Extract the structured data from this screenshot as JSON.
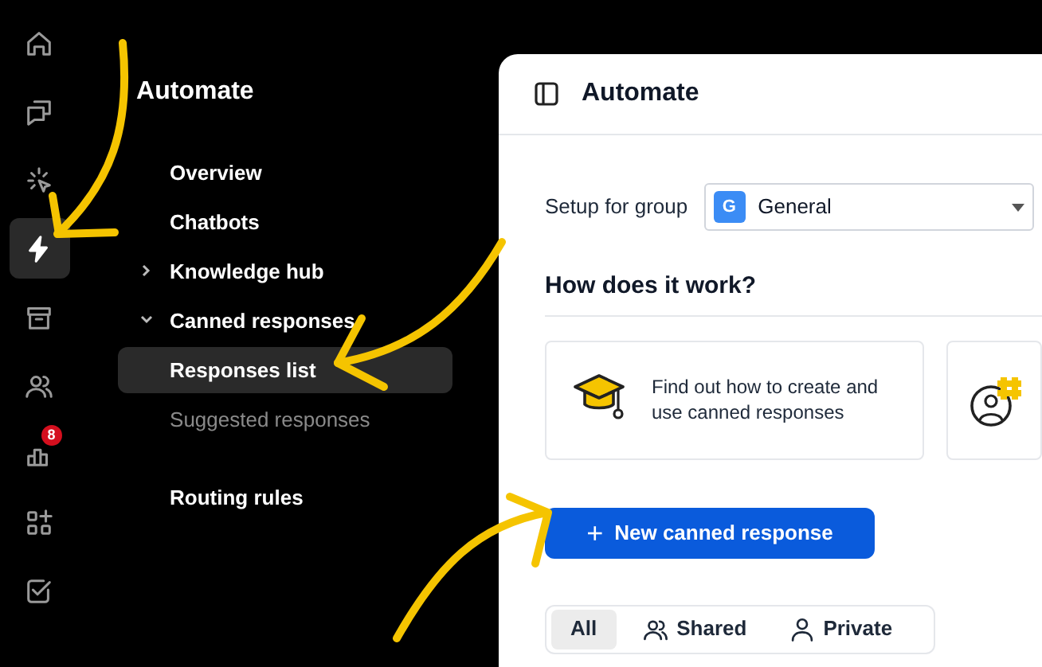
{
  "rail": [
    {
      "kind": "home",
      "selected": false
    },
    {
      "kind": "chat",
      "selected": false
    },
    {
      "kind": "spark",
      "selected": false
    },
    {
      "kind": "bolt",
      "selected": true
    },
    {
      "kind": "archive",
      "selected": false
    },
    {
      "kind": "team",
      "selected": false
    },
    {
      "kind": "chart",
      "selected": false,
      "badge": "8"
    },
    {
      "kind": "apps",
      "selected": false
    },
    {
      "kind": "check",
      "selected": false
    }
  ],
  "nav": {
    "title": "Automate",
    "items": [
      {
        "label": "Overview",
        "selected": false
      },
      {
        "label": "Chatbots",
        "selected": false
      },
      {
        "label": "Knowledge hub",
        "selected": false,
        "expanded": false
      },
      {
        "label": "Canned responses",
        "selected": false,
        "expanded": true,
        "children": [
          {
            "label": "Responses list",
            "selected": true
          },
          {
            "label": "Suggested responses",
            "selected": false
          }
        ]
      }
    ],
    "more_items": [
      {
        "label": "Routing rules",
        "selected": false
      }
    ]
  },
  "main": {
    "title": "Automate",
    "group_label": "Setup for group",
    "group": {
      "initial": "G",
      "name": "General"
    },
    "section_title": "How does it work?",
    "cards": [
      {
        "kind": "graduation",
        "text": "Find out how to create and use canned responses"
      },
      {
        "kind": "hashtag-user"
      }
    ],
    "new_button": {
      "icon": "+",
      "label": "New canned response"
    },
    "filters": [
      {
        "label": "All",
        "selected": true
      },
      {
        "label": "Shared",
        "kind": "team",
        "selected": false
      },
      {
        "label": "Private",
        "kind": "person",
        "selected": false
      }
    ]
  }
}
